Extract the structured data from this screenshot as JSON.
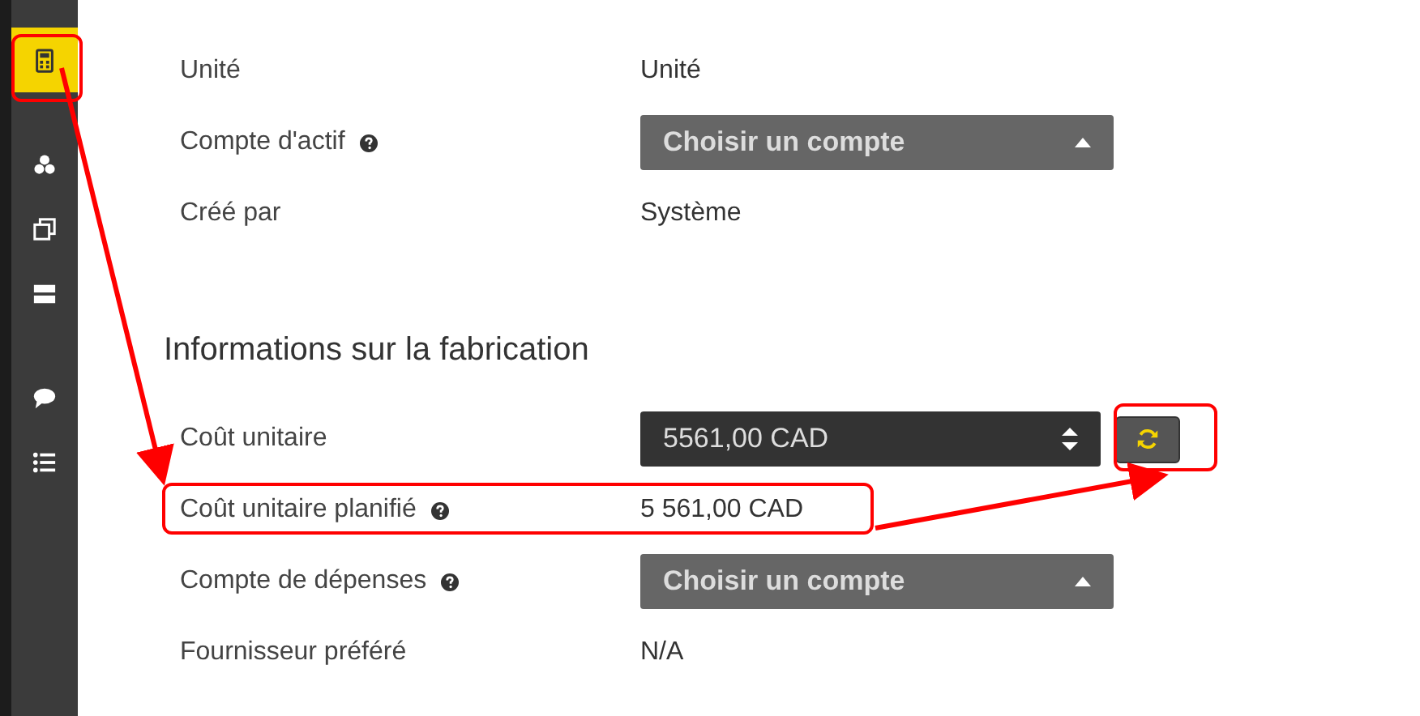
{
  "sidebar": {
    "items": [
      {
        "selected": true
      },
      {
        "selected": false
      },
      {
        "selected": false
      },
      {
        "selected": false
      },
      {
        "selected": false
      },
      {
        "selected": false
      }
    ]
  },
  "sections": [
    {
      "rows": [
        {
          "label": "Unité",
          "help": false,
          "kind": "text",
          "value": "Unité"
        },
        {
          "label": "Compte d'actif",
          "help": true,
          "kind": "select",
          "value": "Choisir un compte"
        },
        {
          "label": "Créé par",
          "help": false,
          "kind": "text",
          "value": "Système"
        }
      ]
    },
    {
      "title": "Informations sur la fabrication",
      "rows": [
        {
          "label": "Coût unitaire",
          "help": false,
          "kind": "number",
          "value": "5561,00 CAD"
        },
        {
          "label": "Coût unitaire planifié",
          "help": true,
          "kind": "text",
          "value": "5 561,00 CAD"
        },
        {
          "label": "Compte de dépenses",
          "help": true,
          "kind": "select",
          "value": "Choisir un compte"
        },
        {
          "label": "Fournisseur préféré",
          "help": false,
          "kind": "text",
          "value": "N/A"
        }
      ]
    }
  ]
}
